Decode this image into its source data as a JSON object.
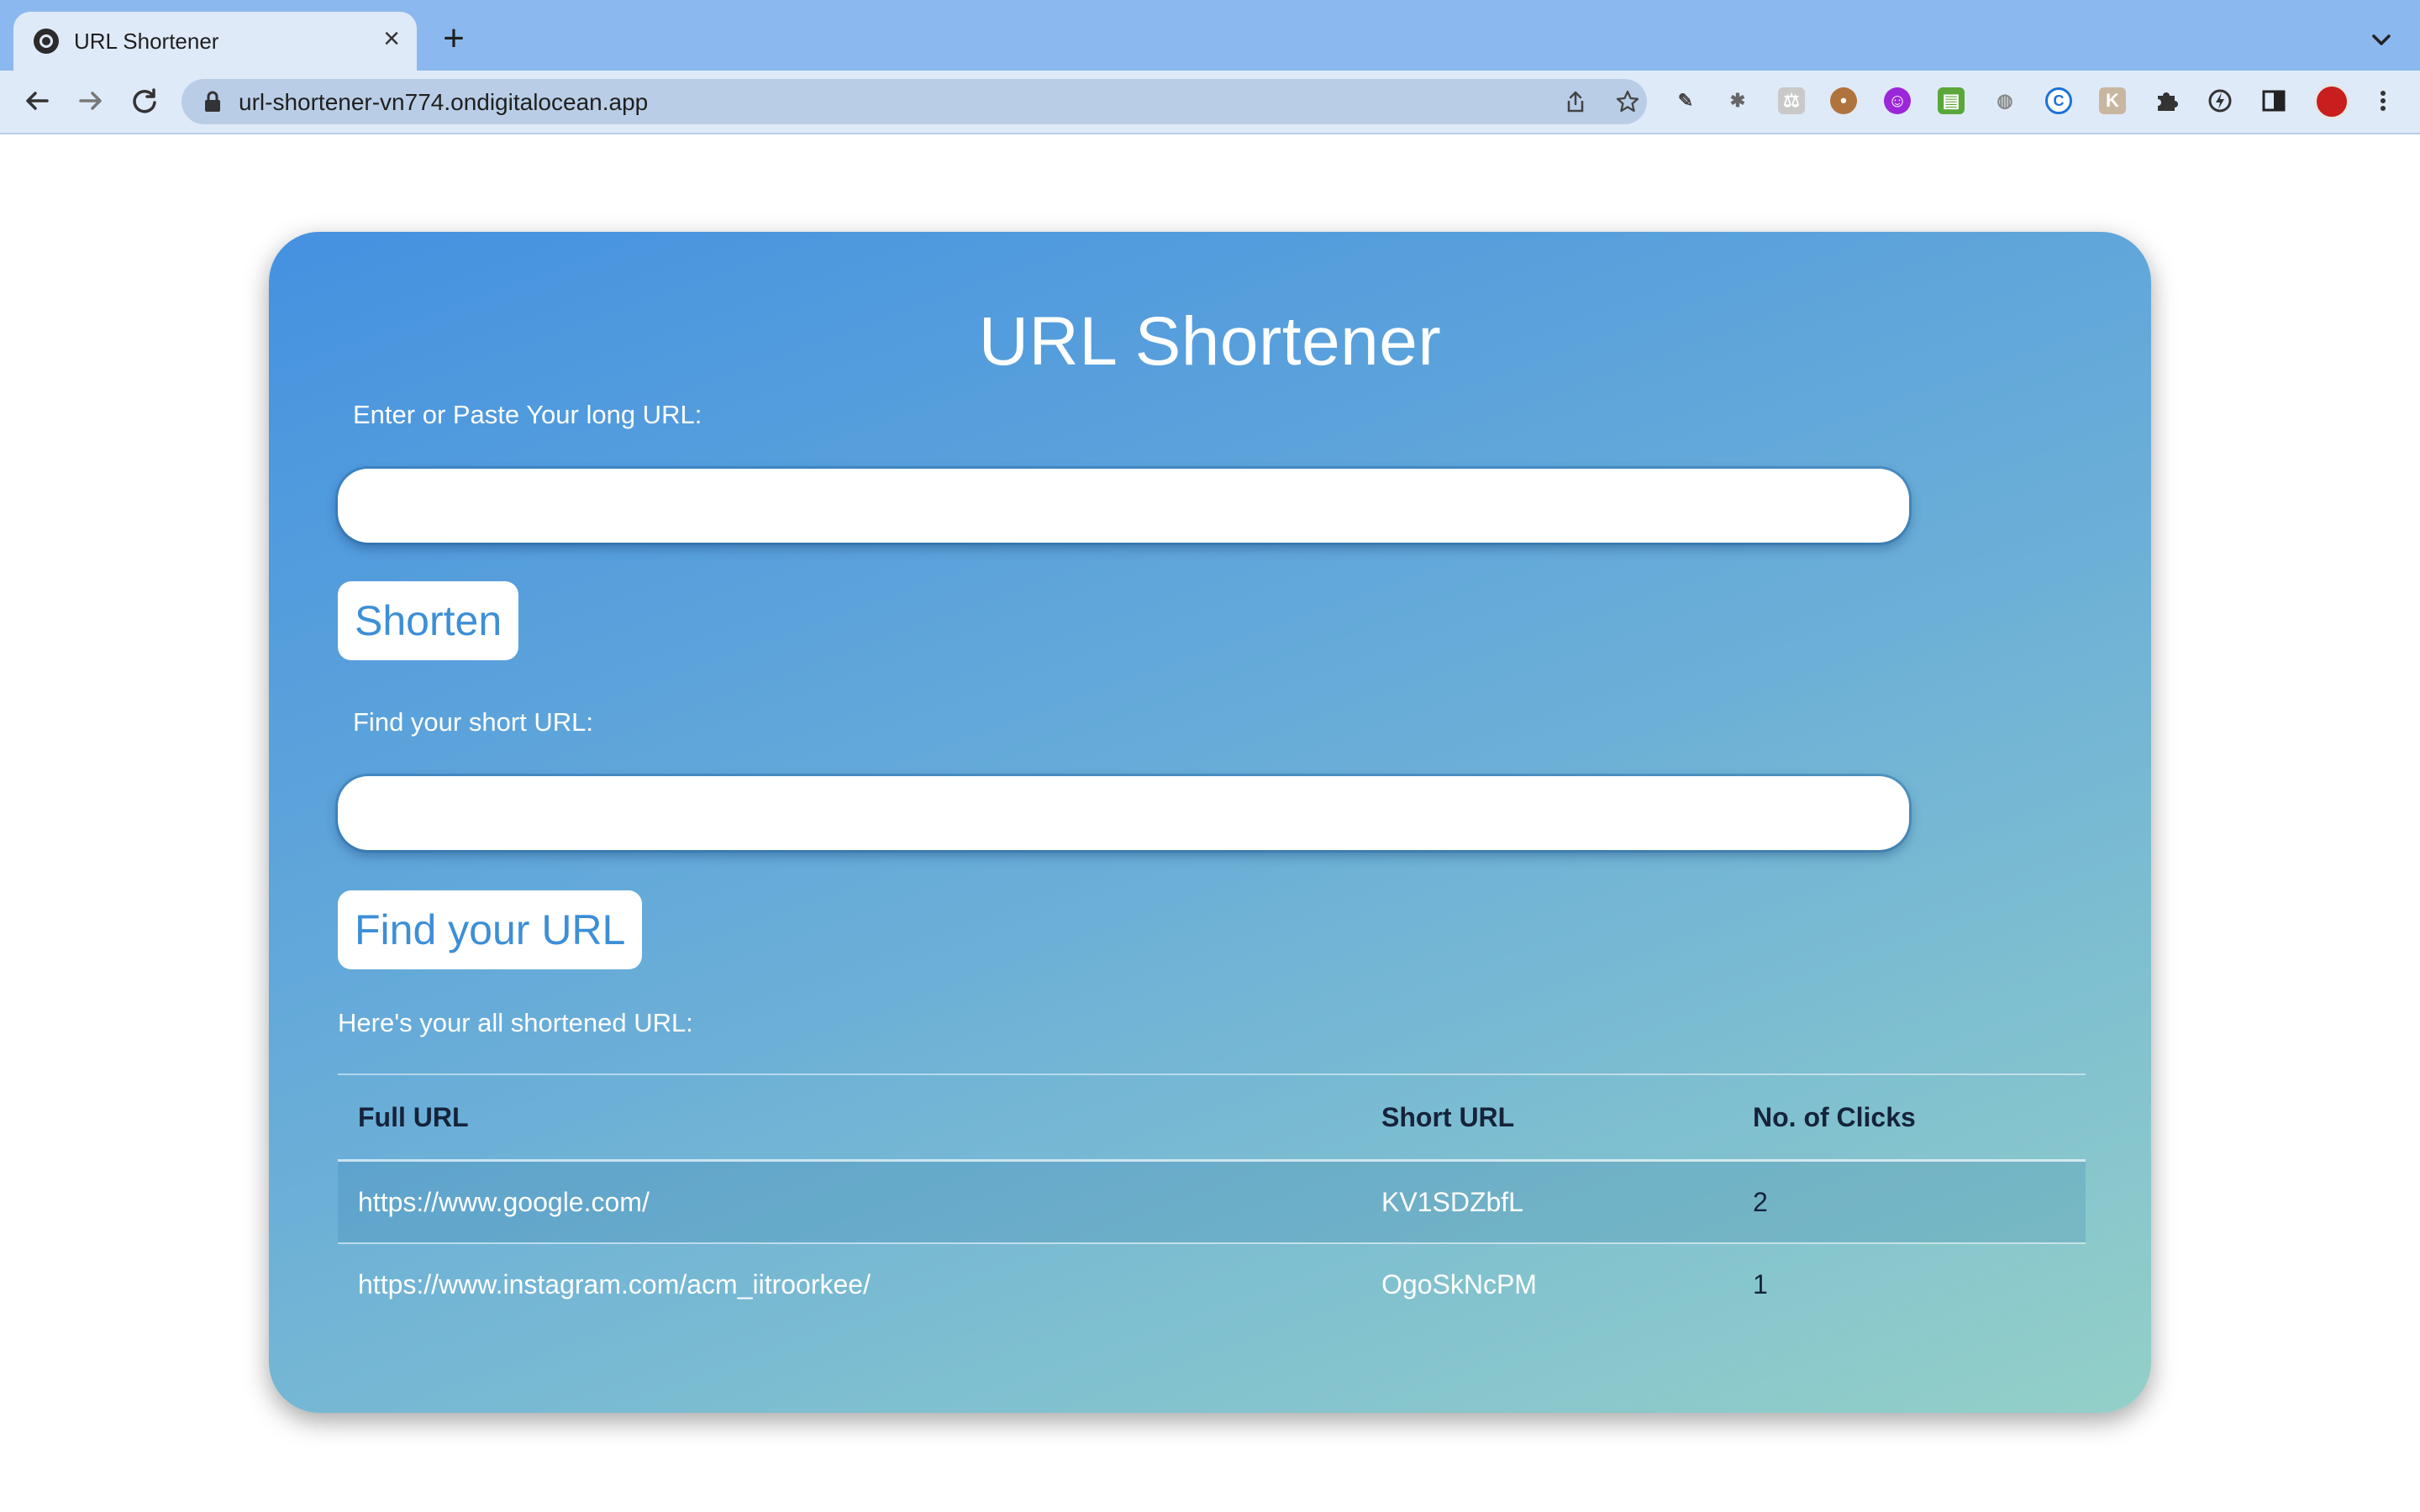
{
  "browser": {
    "tab_title": "URL Shortener",
    "tab_close": "×",
    "new_tab": "+",
    "url": "url-shortener-vn774.ondigitalocean.app",
    "extensions": [
      "pen-tool-icon",
      "bug-icon",
      "scale-icon",
      "cookie-icon",
      "purple-face-icon",
      "printer-icon",
      "mouse-icon",
      "c-circle-icon",
      "k-icon",
      "puzzle-icon",
      "bolt-icon",
      "sidebar-icon",
      "avatar"
    ]
  },
  "page": {
    "title": "URL Shortener",
    "long_url_label": "Enter or Paste Your long URL:",
    "long_url_value": "",
    "shorten_button": "Shorten",
    "find_label": "Find your short URL:",
    "find_value": "",
    "find_button": "Find your URL",
    "list_heading": "Here's your all shortened URL:"
  },
  "table": {
    "headers": [
      "Full URL",
      "Short URL",
      "No. of Clicks"
    ],
    "rows": [
      {
        "full": "https://www.google.com/",
        "short": "KV1SDZbfL",
        "clicks": "2"
      },
      {
        "full": "https://www.instagram.com/acm_iitroorkee/",
        "short": "OgoSkNcPM",
        "clicks": "1"
      }
    ]
  },
  "colors": {
    "gradient_start": "#4591e0",
    "gradient_end": "#93d0c8",
    "button_text": "#3d8fd6",
    "chrome_tab_bar": "#8bb8ee",
    "chrome_toolbar": "#dfeaf8"
  }
}
